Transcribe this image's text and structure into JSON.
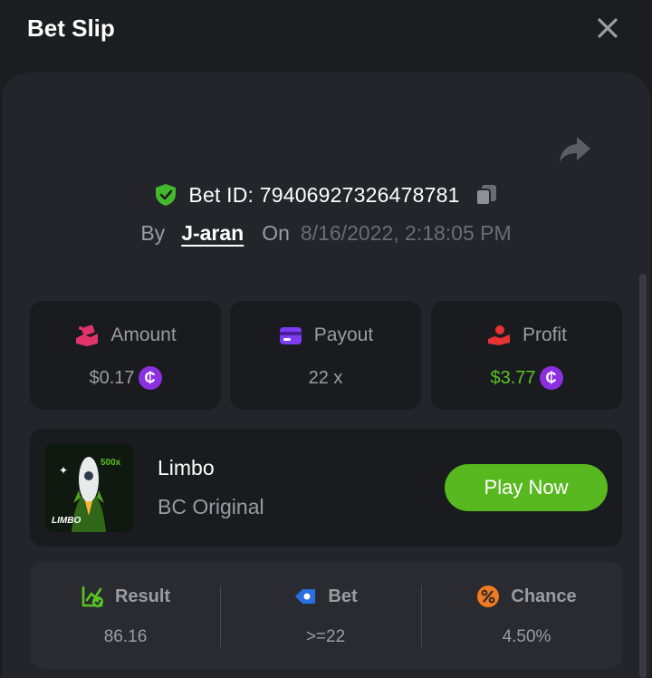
{
  "header": {
    "title": "Bet Slip"
  },
  "bet": {
    "id_text": "Bet ID: 79406927326478781",
    "by_label": "By",
    "user": "J-aran",
    "on_label": "On",
    "date": "8/16/2022, 2:18:05 PM"
  },
  "stats": {
    "amount": {
      "label": "Amount",
      "value": "$0.17"
    },
    "payout": {
      "label": "Payout",
      "value": "22 x"
    },
    "profit": {
      "label": "Profit",
      "value": "$3.77"
    },
    "coin_symbol": "₵"
  },
  "game": {
    "name": "Limbo",
    "subtitle": "BC Original",
    "thumb_text": "LIMBO",
    "thumb_badge": "500x",
    "play_label": "Play Now"
  },
  "results": {
    "result": {
      "label": "Result",
      "value": "86.16"
    },
    "bet": {
      "label": "Bet",
      "value": ">=22"
    },
    "chance": {
      "label": "Chance",
      "value": "4.50%"
    }
  },
  "colors": {
    "background": "#1c1d20",
    "panel": "#24252a",
    "card": "#1a1b1e",
    "accent_green": "#58b81f",
    "profit_green": "#58c324",
    "coin_purple": "#8b2fe0",
    "muted_text": "#9a9ca3"
  },
  "icons": {
    "close": "close-icon",
    "share": "share-icon",
    "shield": "shield-check-icon",
    "copy": "copy-icon",
    "amount": "money-hand-icon",
    "payout": "wallet-card-icon",
    "profit": "profit-hand-icon",
    "result": "chart-check-icon",
    "bet": "bet-ticket-icon",
    "chance": "percent-icon"
  }
}
